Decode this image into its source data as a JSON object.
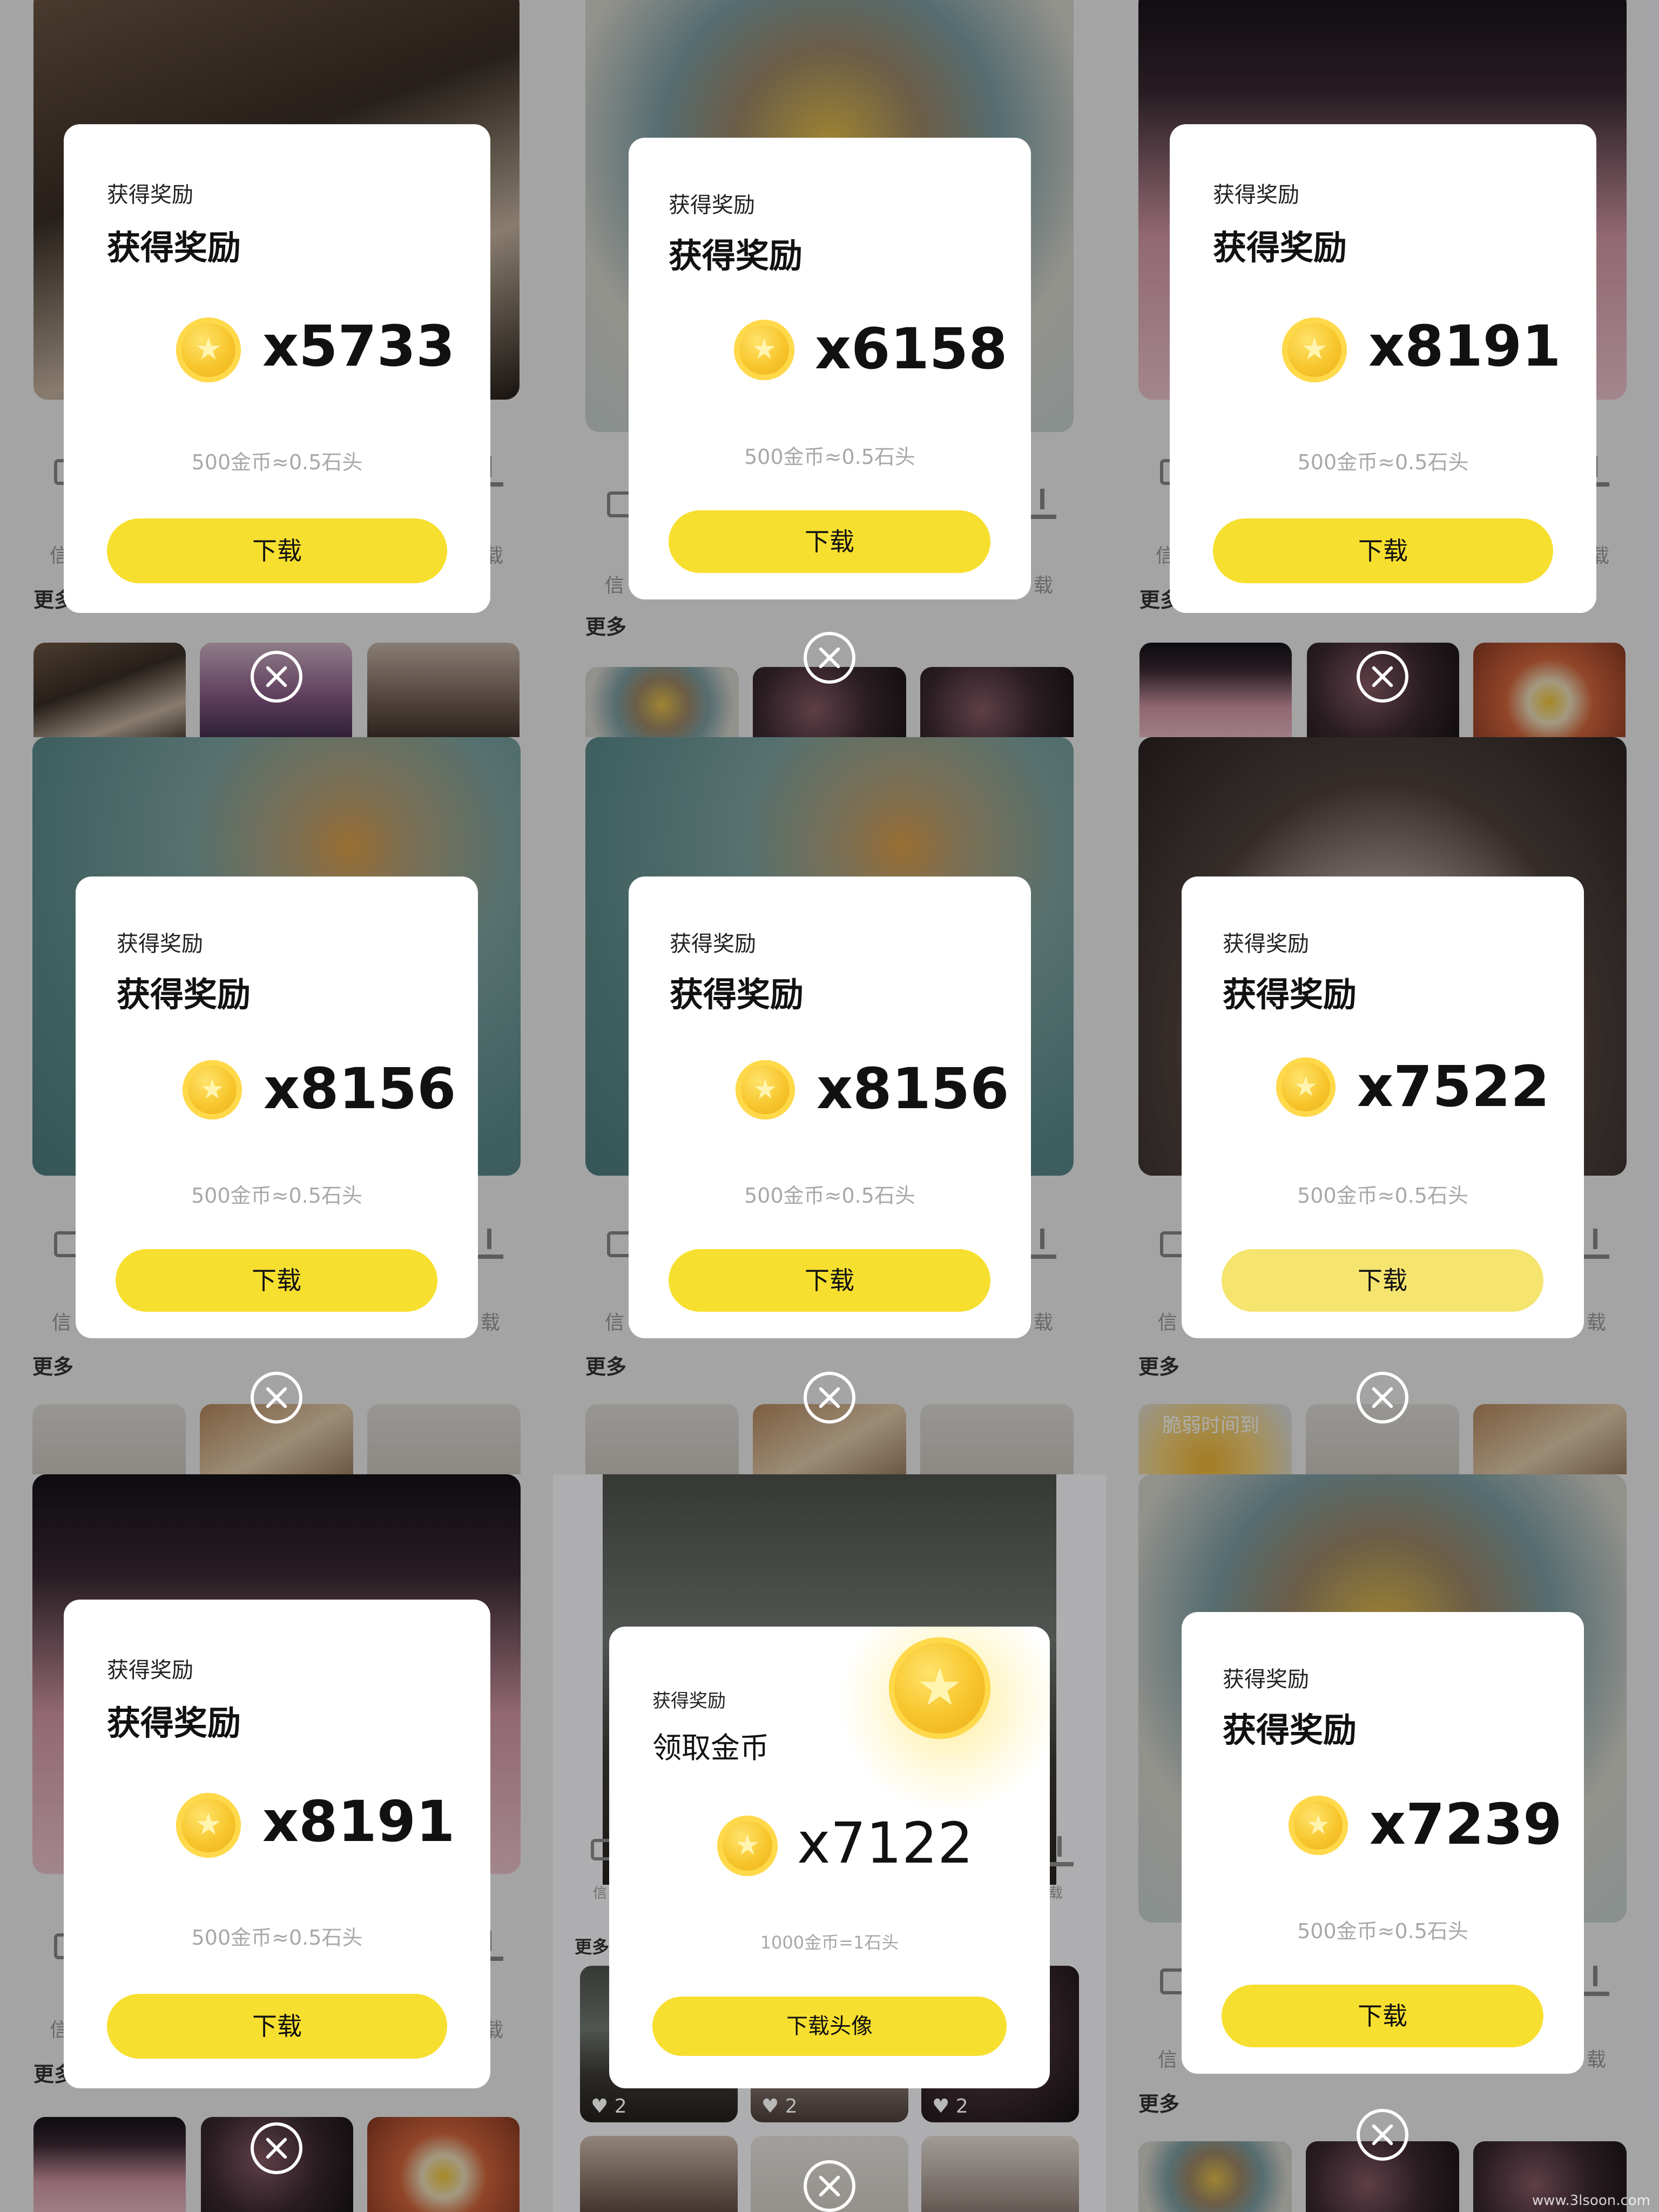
{
  "panels": [
    {
      "small": "获得奖励",
      "title": "获得奖励",
      "amount": "x5733",
      "rate": "500金币≈0.5石头",
      "button": "下载"
    },
    {
      "small": "获得奖励",
      "title": "获得奖励",
      "amount": "x6158",
      "rate": "500金币≈0.5石头",
      "button": "下载"
    },
    {
      "small": "获得奖励",
      "title": "获得奖励",
      "amount": "x8191",
      "rate": "500金币≈0.5石头",
      "button": "下载"
    },
    {
      "small": "获得奖励",
      "title": "获得奖励",
      "amount": "x8156",
      "rate": "500金币≈0.5石头",
      "button": "下载"
    },
    {
      "small": "获得奖励",
      "title": "获得奖励",
      "amount": "x8156",
      "rate": "500金币≈0.5石头",
      "button": "下载"
    },
    {
      "small": "获得奖励",
      "title": "获得奖励",
      "amount": "x7522",
      "rate": "500金币≈0.5石头",
      "button": "下载"
    },
    {
      "small": "获得奖励",
      "title": "获得奖励",
      "amount": "x8191",
      "rate": "500金币≈0.5石头",
      "button": "下载"
    },
    {
      "small": "获得奖励",
      "title": "领取金币",
      "amount": "x7122",
      "rate": "1000金币=1石头",
      "button": "下载头像"
    },
    {
      "small": "获得奖励",
      "title": "获得奖励",
      "amount": "x7239",
      "rate": "500金币≈0.5石头",
      "button": "下载"
    }
  ],
  "background": {
    "more_label": "更多",
    "info_fragment": "信",
    "download_fragment": "载",
    "cartoon_caption": "脆弱时间到",
    "like_count": "2"
  },
  "watermark": "www.3lsoon.com"
}
